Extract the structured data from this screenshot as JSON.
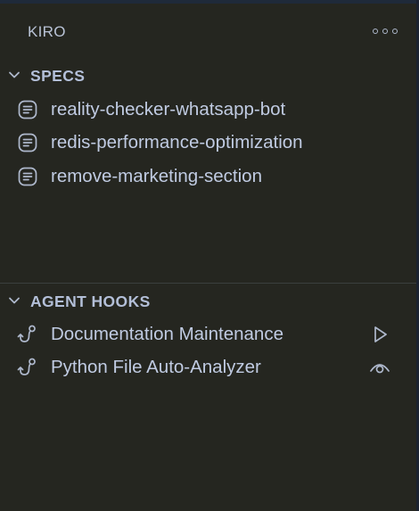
{
  "panel": {
    "title": "KIRO"
  },
  "specs": {
    "header": "SPECS",
    "items": [
      {
        "label": "reality-checker-whatsapp-bot",
        "icon": "document-lines-icon"
      },
      {
        "label": "redis-performance-optimization",
        "icon": "document-lines-icon"
      },
      {
        "label": "remove-marketing-section",
        "icon": "document-lines-icon"
      }
    ]
  },
  "hooks": {
    "header": "AGENT HOOKS",
    "items": [
      {
        "label": "Documentation Maintenance",
        "icon": "hook-icon",
        "action": "play-icon"
      },
      {
        "label": "Python File Auto-Analyzer",
        "icon": "hook-icon",
        "action": "eye-icon"
      }
    ]
  },
  "colors": {
    "background": "#252620",
    "text": "#c0cbe2",
    "header_text": "#b3bfd8",
    "divider": "#3a3f3e"
  }
}
